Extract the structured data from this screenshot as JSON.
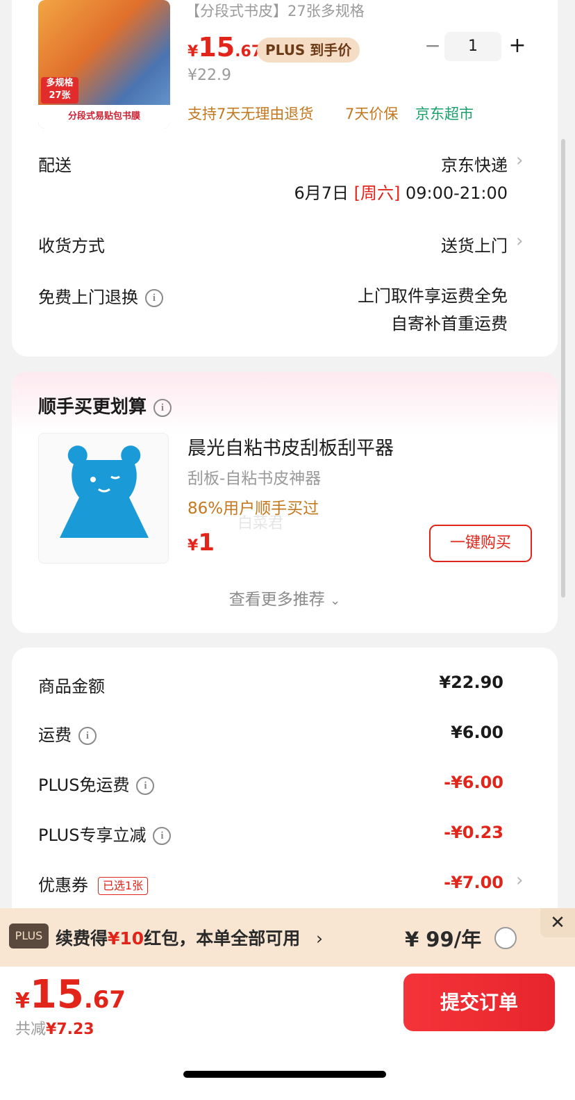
{
  "product": {
    "title": "【分段式书皮】27张多规格",
    "thumb_tag": "多规格\n27张",
    "thumb_banner": "分段式易贴包书膜",
    "price_symbol": "¥",
    "price_int": "15",
    "price_dec": ".67",
    "plus_pill": "PLUS 到手价",
    "orig_price": "¥22.9",
    "qty_minus": "−",
    "qty": "1",
    "qty_plus": "+",
    "svc_return": "支持7天无理由退货",
    "svc_price": "7天价保",
    "svc_store": "京东超市"
  },
  "delivery": {
    "label": "配送",
    "carrier": "京东快递",
    "date": "6月7日",
    "weekday": "[周六]",
    "time": "09:00-21:00"
  },
  "receive": {
    "label": "收货方式",
    "value": "送货上门"
  },
  "returns": {
    "label": "免费上门退换",
    "line1": "上门取件享运费全免",
    "line2": "自寄补首重运费"
  },
  "addon": {
    "title": "顺手买更划算",
    "name": "晨光自粘书皮刮板刮平器",
    "sub": "刮板-自粘书皮神器",
    "stat": "86%用户顺手买过",
    "price_symbol": "¥",
    "price_int": "1",
    "watermark": "白菜君",
    "buy_label": "一键购买",
    "more_label": "查看更多推荐"
  },
  "summary": {
    "rows": [
      {
        "label": "商品金额",
        "value": "¥22.90"
      },
      {
        "label": "运费",
        "value": "¥6.00"
      },
      {
        "label": "PLUS免运费",
        "value": "-¥6.00"
      },
      {
        "label": "PLUS专享立减",
        "value": "-¥0.23"
      },
      {
        "label": "优惠券",
        "badge": "已选1张",
        "value": "-¥7.00"
      }
    ]
  },
  "plus_bar": {
    "logo": "PLUS",
    "text_a": "续费得",
    "text_amt": "¥10",
    "text_b": "红包，本单全部可用",
    "arrow": "›",
    "price": "¥ 99/年",
    "close": "✕"
  },
  "bottom": {
    "price_symbol": "¥",
    "price_int": "15",
    "price_dec": ".67",
    "saved_label": "共减",
    "saved_amt": "¥7.23",
    "submit": "提交订单"
  },
  "colors": {
    "accent_red": "#e1251b",
    "gold": "#c3781f",
    "green": "#19a06b",
    "plus_bar_bg": "#f8e5d2"
  }
}
